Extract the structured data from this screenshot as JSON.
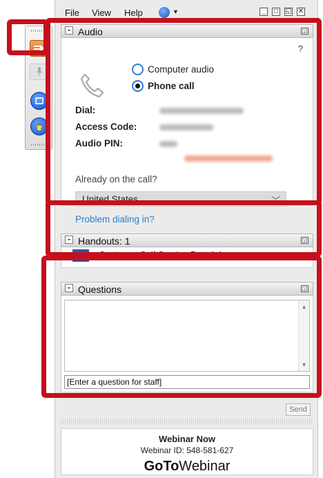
{
  "menu": {
    "file": "File",
    "view": "View",
    "help": "Help"
  },
  "window_controls": {
    "minimize": "_",
    "maximize": "□",
    "restore": "◱",
    "close": "✕"
  },
  "audio": {
    "title": "Audio",
    "help": "?",
    "options": [
      {
        "label": "Computer audio",
        "selected": false
      },
      {
        "label": "Phone call",
        "selected": true
      }
    ],
    "dial_label": "Dial:",
    "access_label": "Access Code:",
    "pin_label": "Audio PIN:",
    "already_label": "Already on the call?",
    "country": "United States",
    "problem_link": "Problem dialing in?"
  },
  "handouts": {
    "title": "Handouts: 1",
    "file_name": "Customer Self Service Portal.docx"
  },
  "questions": {
    "title": "Questions",
    "placeholder": "[Enter a question for staff]",
    "send_label": "Send"
  },
  "footer": {
    "title": "Webinar Now",
    "webinar_id": "Webinar ID: 548-581-627",
    "brand_bold": "GoTo",
    "brand_regular": "Webinar"
  },
  "colors": {
    "highlight": "#c5101c",
    "link": "#2a80c8",
    "radio": "#2d7fd8"
  }
}
